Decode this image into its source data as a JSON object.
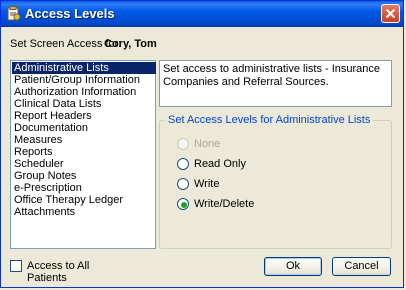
{
  "window": {
    "title": "Access Levels"
  },
  "access": {
    "label": "Set Screen Access for:",
    "user": "Cory, Tom"
  },
  "list": {
    "items": [
      "Administrative Lists",
      "Patient/Group Information",
      "Authorization Information",
      "Clinical Data Lists",
      "Report Headers",
      "Documentation",
      "Measures",
      "Reports",
      "Scheduler",
      "Group Notes",
      "e-Prescription",
      "Office Therapy Ledger",
      "Attachments"
    ],
    "selected": "Administrative Lists"
  },
  "description": "Set access to administrative lists - Insurance Companies and Referral Sources.",
  "levels": {
    "title": "Set Access Levels for Administrative Lists",
    "options": [
      "None",
      "Read Only",
      "Write",
      "Write/Delete"
    ],
    "selected": "Write/Delete",
    "disabled": [
      "None"
    ]
  },
  "all_patients": {
    "label": "Access to All Patients",
    "checked": false
  },
  "buttons": {
    "ok": "Ok",
    "cancel": "Cancel"
  },
  "colors": {
    "title_bar": "#0058e6",
    "selection": "#0a246a",
    "radio_dot": "#21a121",
    "group_title": "#0046d5"
  }
}
